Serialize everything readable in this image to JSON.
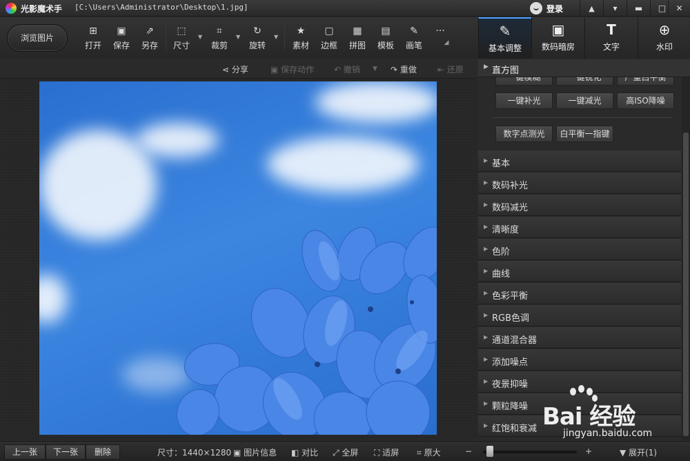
{
  "window": {
    "app_title": "光影魔术手",
    "file_path": "[C:\\Users\\Administrator\\Desktop\\1.jpg]",
    "login_label": "登录",
    "controls": [
      "▾",
      "▬",
      "□",
      "✕"
    ]
  },
  "toolbar": {
    "browse_label": "浏览图片",
    "tools": [
      {
        "label": "打开",
        "icon": "⊞"
      },
      {
        "label": "保存",
        "icon": "▣"
      },
      {
        "label": "另存",
        "icon": "⇗"
      },
      {
        "label": "尺寸",
        "icon": "⬚"
      },
      {
        "label": "裁剪",
        "icon": "⌗"
      },
      {
        "label": "旋转",
        "icon": "↻"
      },
      {
        "label": "素材",
        "icon": "★"
      },
      {
        "label": "边框",
        "icon": "▢"
      },
      {
        "label": "拼图",
        "icon": "▦"
      },
      {
        "label": "模板",
        "icon": "▤"
      },
      {
        "label": "画笔",
        "icon": "✎"
      },
      {
        "label": "",
        "icon": "···"
      }
    ]
  },
  "tabs": [
    {
      "label": "基本调整",
      "icon": "✎",
      "active": true
    },
    {
      "label": "数码暗房",
      "icon": "▣",
      "active": false
    },
    {
      "label": "文字",
      "icon": "T",
      "active": false
    },
    {
      "label": "水印",
      "icon": "⊕",
      "active": false
    }
  ],
  "actions": {
    "share": "分享",
    "save_action": "保存动作",
    "undo": "撤销",
    "redo": "重做",
    "restore": "还原"
  },
  "panel": {
    "histogram_label": "直方图",
    "quick_buttons_partial": [
      "一键模糊",
      "一键锐化",
      "严重白平衡"
    ],
    "quick_buttons": [
      "一键补光",
      "一键减光",
      "高ISO降噪"
    ],
    "extra_buttons": [
      "数字点测光",
      "白平衡一指键"
    ],
    "sections": [
      "基本",
      "数码补光",
      "数码减光",
      "清晰度",
      "色阶",
      "曲线",
      "色彩平衡",
      "RGB色调",
      "通道混合器",
      "添加噪点",
      "夜景抑噪",
      "颗粒降噪",
      "红饱和衰减"
    ]
  },
  "status": {
    "prev": "上一张",
    "next": "下一张",
    "delete": "删除",
    "size": "尺寸：1440×1280",
    "info": "图片信息",
    "compare": "对比",
    "fullscreen": "全屏",
    "fit": "适屏",
    "original": "原大",
    "zoom_minus": "−",
    "zoom_plus": "+",
    "expand": "展开(1)"
  },
  "watermark": {
    "brand": "Bai  经验",
    "url": "jingyan.baidu.com"
  },
  "colors": {
    "accent": "#4aa3ff",
    "sky": "#2f78d8",
    "flower": "#4f88e8"
  }
}
